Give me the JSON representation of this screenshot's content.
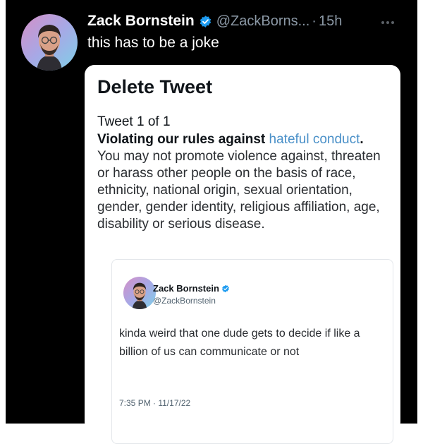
{
  "post": {
    "display_name": "Zack Bornstein",
    "handle": "@ZackBorns...",
    "separator": "·",
    "time": "15h",
    "text": "this has to be a joke"
  },
  "card": {
    "title": "Delete Tweet",
    "tweet_count": "Tweet 1 of 1",
    "violation_prefix": "Violating our rules against ",
    "violation_link": "hateful conduct",
    "violation_suffix": ".",
    "violation_body": "You may not promote violence against, threaten or harass other people on the basis of race, ethnicity, national origin, sexual orientation, gender, gender identity, religious affiliation, age, disability or serious disease."
  },
  "embedded_tweet": {
    "display_name": "Zack Bornstein",
    "handle": "@ZackBornstein",
    "text": "kinda weird that one dude gets to decide if like a billion of us can communicate or not",
    "timestamp": "7:35 PM · 11/17/22"
  },
  "icons": {
    "verified": "verified-badge-icon",
    "more": "more-options-icon"
  },
  "colors": {
    "background_dark": "#000000",
    "verified_blue": "#1d9bf0",
    "link_blue": "#4a90c8",
    "muted_text": "#8b98a5"
  }
}
